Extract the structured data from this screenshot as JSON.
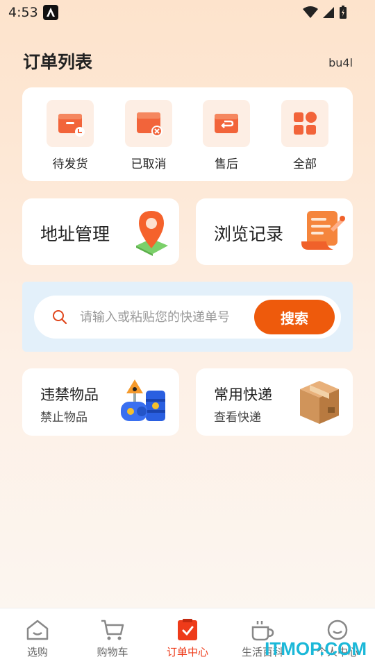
{
  "status_bar": {
    "time": "4:53"
  },
  "header": {
    "title": "订单列表",
    "user": "bu4l"
  },
  "orders": [
    {
      "label": "待发货",
      "icon": "pending-shipment-icon"
    },
    {
      "label": "已取消",
      "icon": "cancelled-icon"
    },
    {
      "label": "售后",
      "icon": "after-sales-icon"
    },
    {
      "label": "全部",
      "icon": "all-orders-icon"
    }
  ],
  "features": {
    "address": {
      "label": "地址管理",
      "icon": "map-pin-icon"
    },
    "history": {
      "label": "浏览记录",
      "icon": "scroll-icon"
    }
  },
  "search": {
    "placeholder": "请输入或粘贴您的快递单号",
    "button": "搜索"
  },
  "info_cards": {
    "prohibited": {
      "title": "违禁物品",
      "subtitle": "禁止物品",
      "icon": "hazard-barrels-icon"
    },
    "express": {
      "title": "常用快递",
      "subtitle": "查看快递",
      "icon": "package-box-icon"
    }
  },
  "tabbar": [
    {
      "label": "选购",
      "icon": "home-icon",
      "active": false
    },
    {
      "label": "购物车",
      "icon": "cart-icon",
      "active": false
    },
    {
      "label": "订单中心",
      "icon": "orders-icon",
      "active": true
    },
    {
      "label": "生活百科",
      "icon": "cup-icon",
      "active": false
    },
    {
      "label": "个人中心",
      "icon": "profile-icon",
      "active": false
    }
  ],
  "watermark": "ITMOP.COM",
  "colors": {
    "accent": "#ee5a0c",
    "active_tab": "#ee3b1a",
    "search_bg": "#e3f0fa"
  }
}
